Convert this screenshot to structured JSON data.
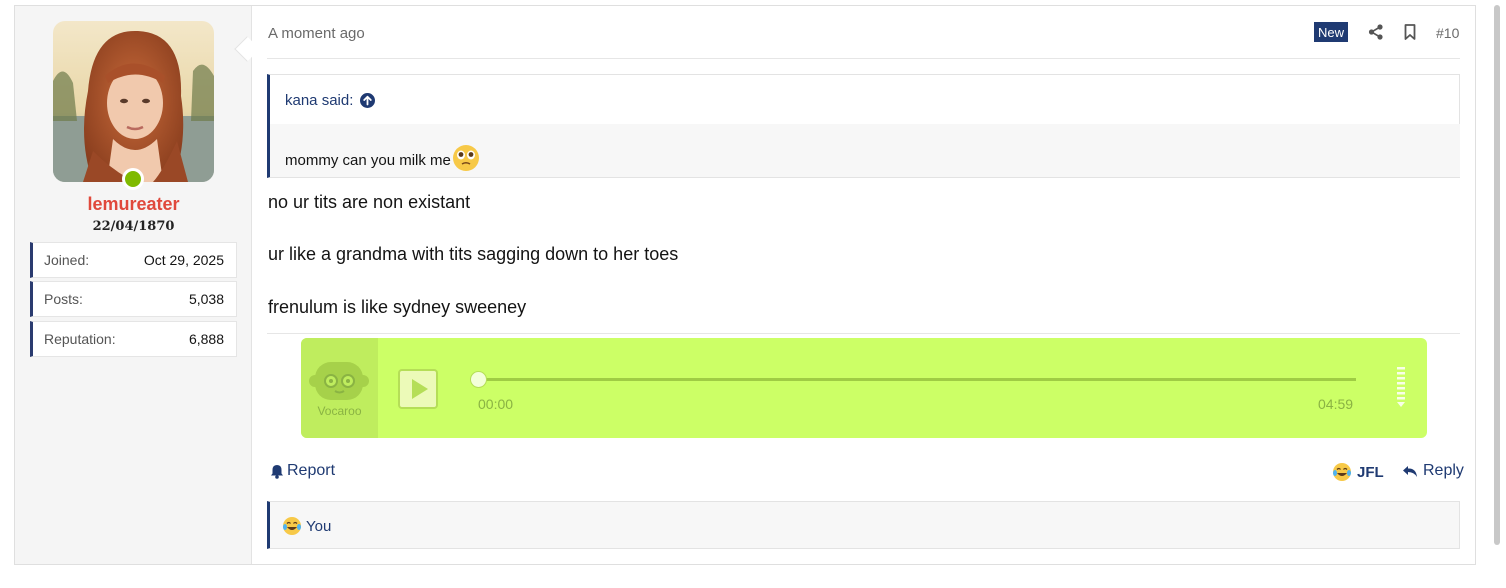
{
  "user": {
    "username": "lemureater",
    "title": "22/04/1870",
    "online": true,
    "stats": [
      {
        "label": "Joined:",
        "value": "Oct 29, 2025"
      },
      {
        "label": "Posts:",
        "value": "5,038"
      },
      {
        "label": "Reputation:",
        "value": "6,888"
      }
    ]
  },
  "post": {
    "time": "A moment ago",
    "badge": "New",
    "number": "#10",
    "icons": {
      "share": "share-icon",
      "bookmark": "bookmark-icon"
    },
    "quote": {
      "author_label": "kana said:",
      "text": "mommy can you milk me",
      "emoji": "face-holding-back-tears-emoji"
    },
    "lines": [
      "no ur tits are non existant",
      "ur like a grandma with tits sagging down to her toes",
      "frenulum is like sydney sweeney"
    ],
    "embed": {
      "brand": "Vocaroo",
      "time_start": "00:00",
      "time_end": "04:59",
      "progress": 0
    },
    "actions": {
      "report": "Report",
      "react": "JFL",
      "reply": "Reply"
    },
    "reactions": {
      "emoji": "crying-laughing-emoji",
      "users": "You"
    }
  },
  "colors": {
    "accent": "#1f3a72",
    "username": "#e0493c",
    "online": "#7fba00",
    "embed_bg": "#ccff66"
  }
}
